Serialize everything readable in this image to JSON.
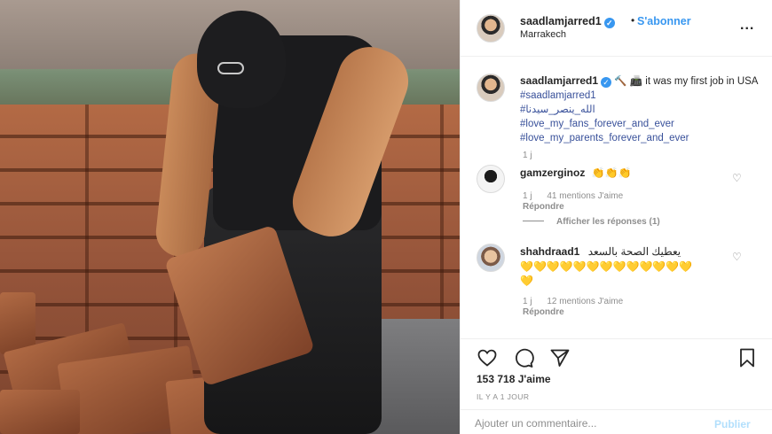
{
  "post": {
    "username": "saadlamjarred1",
    "follow_label": "S'abonner",
    "separator": "•",
    "location": "Marrakech",
    "more_label": "...",
    "caption": {
      "username": "saadlamjarred1",
      "text_start": "🔨 📠 it was my first job in USA",
      "tag_1": "#saadlamjarred1",
      "tag_2": "#الله_ينصر_سيدنا",
      "tag_3": "#love_my_fans_forever_and_ever",
      "tag_4": "#love_my_parents_forever_and_ever",
      "time": "1 j"
    },
    "comments": [
      {
        "username": "gamzerginoz",
        "emoji": "👏👏👏",
        "time": "1 j",
        "likes": "41 mentions J'aime",
        "reply_label": "Répondre",
        "view_replies": "Afficher les réponses (1)"
      },
      {
        "username": "shahdraad1",
        "text": "يعطيك الصحة بالسعد",
        "emoji": "💛💛💛💛💛💛💛💛💛💛💛💛💛💛",
        "time": "1 j",
        "likes": "12 mentions J'aime",
        "reply_label": "Répondre"
      }
    ],
    "likes_count": "153 718 J'aime",
    "posted_time": "IL Y A 1 JOUR",
    "comment_placeholder": "Ajouter un commentaire...",
    "publish_label": "Publier"
  },
  "icons": {
    "verified": "verified-badge-icon",
    "heart": "heart-icon",
    "comment": "comment-icon",
    "share": "share-icon",
    "save": "bookmark-icon",
    "more": "more-options-icon"
  },
  "colors": {
    "link_blue": "#3897f0",
    "hashtag": "#38509a",
    "muted": "#8e8e8e",
    "text": "#262626",
    "publish_disabled": "#b2dffc"
  }
}
